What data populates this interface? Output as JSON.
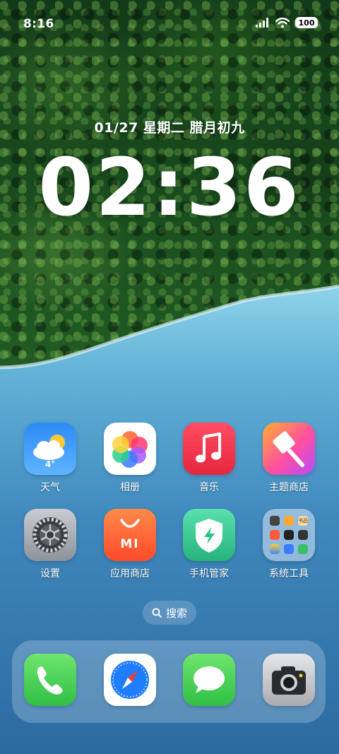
{
  "status_bar": {
    "time": "8:16",
    "battery": "100"
  },
  "lockscreen": {
    "date": "01/27 星期二 腊月初九",
    "time": "02:36"
  },
  "apps": [
    {
      "label": "天气",
      "icon": "weather-icon",
      "temp": "4°"
    },
    {
      "label": "相册",
      "icon": "gallery-icon"
    },
    {
      "label": "音乐",
      "icon": "music-icon"
    },
    {
      "label": "主题商店",
      "icon": "theme-store-icon"
    },
    {
      "label": "设置",
      "icon": "settings-gear-icon"
    },
    {
      "label": "应用商店",
      "icon": "app-store-icon",
      "badge": "MI"
    },
    {
      "label": "手机管家",
      "icon": "security-shield-icon"
    },
    {
      "label": "系统工具",
      "icon": "folder-icon",
      "folder_tag": "书品"
    }
  ],
  "search": {
    "label": "搜索"
  },
  "dock": [
    {
      "icon": "phone-icon"
    },
    {
      "icon": "browser-compass-icon"
    },
    {
      "icon": "messages-icon"
    },
    {
      "icon": "camera-icon"
    }
  ],
  "colors": {
    "forest": "#1f5a22",
    "water": "#5aa6cf",
    "music_red": "#f0304a",
    "store_orange": "#ff6a3a",
    "shield_green": "#38c48c",
    "phone_green": "#4ed25a"
  }
}
